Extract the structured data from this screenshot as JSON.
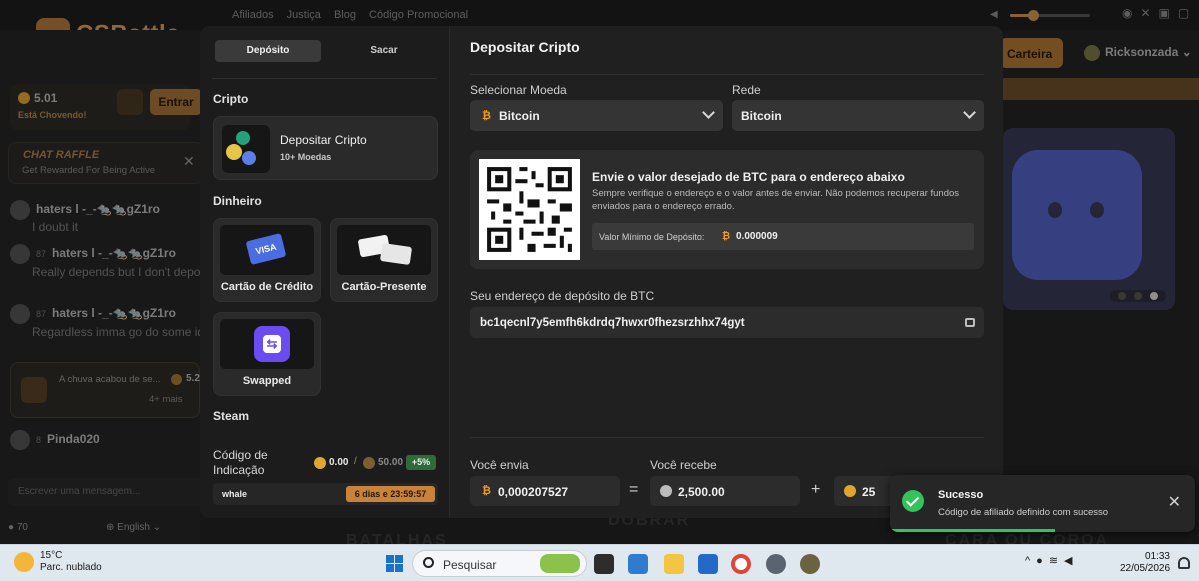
{
  "site": {
    "logo_text": "CSBattle",
    "nav": [
      "Afiliados",
      "Justiça",
      "Blog",
      "Código Promocional"
    ],
    "wallet_button": "Carteira",
    "username": "Ricksonzada"
  },
  "sidebar": {
    "balance": "5.01",
    "rain_status": "Está Chovendo!",
    "enter_button": "Entrar",
    "raffle_title": "CHAT RAFFLE",
    "raffle_sub": "Get Rewarded For Being Active",
    "messages": [
      {
        "level": "",
        "user": "haters l -_-🐀🐀gZ1ro",
        "text": "I doubt it"
      },
      {
        "level": "87",
        "user": "haters l -_-🐀🐀gZ1ro",
        "text": "Really depends but I don't depo offen here cuz I always get raile"
      },
      {
        "level": "87",
        "user": "haters l -_-🐀🐀gZ1ro",
        "text": "Regardless imma go do some idl if I'll be back"
      }
    ],
    "rain_box": {
      "text": "A chuva acabou de se...",
      "amount": "5.2",
      "more": "4+ mais"
    },
    "last_user": {
      "level": "8",
      "user": "Pinda020"
    },
    "chat_placeholder": "Escrever uma mensagem...",
    "online": "70",
    "language": "English"
  },
  "modal": {
    "tabs": [
      "Depósito",
      "Sacar"
    ],
    "sections": {
      "crypto": "Cripto",
      "money": "Dinheiro",
      "steam": "Steam"
    },
    "crypto_card": {
      "title": "Depositar Cripto",
      "subtitle": "10+ Moedas"
    },
    "pay_cards": [
      {
        "label": "Cartão de Crédito",
        "badge": "VISA"
      },
      {
        "label": "Cartão-Presente",
        "badge": ""
      },
      {
        "label": "Swapped",
        "badge": ""
      }
    ],
    "referral": {
      "label": "Código de Indicação",
      "value_a": "0.00",
      "separator": "/",
      "value_b": "50.00",
      "bonus": "+5%",
      "code": "whale",
      "timer": "6 dias e 23:59:57"
    },
    "title": "Depositar Cripto",
    "currency_label": "Selecionar Moeda",
    "currency_value": "Bitcoin",
    "network_label": "Rede",
    "network_value": "Bitcoin",
    "qr_title": "Envie o valor desejado de BTC para o endereço abaixo",
    "qr_desc": "Sempre verifique o endereço e o valor antes de enviar. Não podemos recuperar fundos enviados para o endereço errado.",
    "min_label": "Valor Mínimo de Depósito:",
    "min_value": "0.000009",
    "address_label": "Seu endereço de depósito de BTC",
    "address": "bc1qecnl7y5emfh6kdrdq7hwxr0fhezsrzhhx74gyt",
    "send_label": "Você envia",
    "send_value": "0,000207527",
    "eq": "=",
    "receive_label": "Você recebe",
    "receive_value": "2,500.00",
    "plus": "+",
    "bonus_value": "25"
  },
  "background": {
    "footer": [
      "BATALHAS",
      "DOBRAR",
      "CARA OU COROA"
    ]
  },
  "toast": {
    "title": "Sucesso",
    "message": "Código de afiliado definido com sucesso",
    "close": "✕"
  },
  "taskbar": {
    "temperature": "15°C",
    "weather": "Parc. nublado",
    "search_placeholder": "Pesquisar",
    "time": "01:33",
    "date": "22/05/2026"
  },
  "colors": {
    "accent": "#c8823a",
    "success": "#34c25a",
    "bitcoin": "#f09a1f"
  }
}
